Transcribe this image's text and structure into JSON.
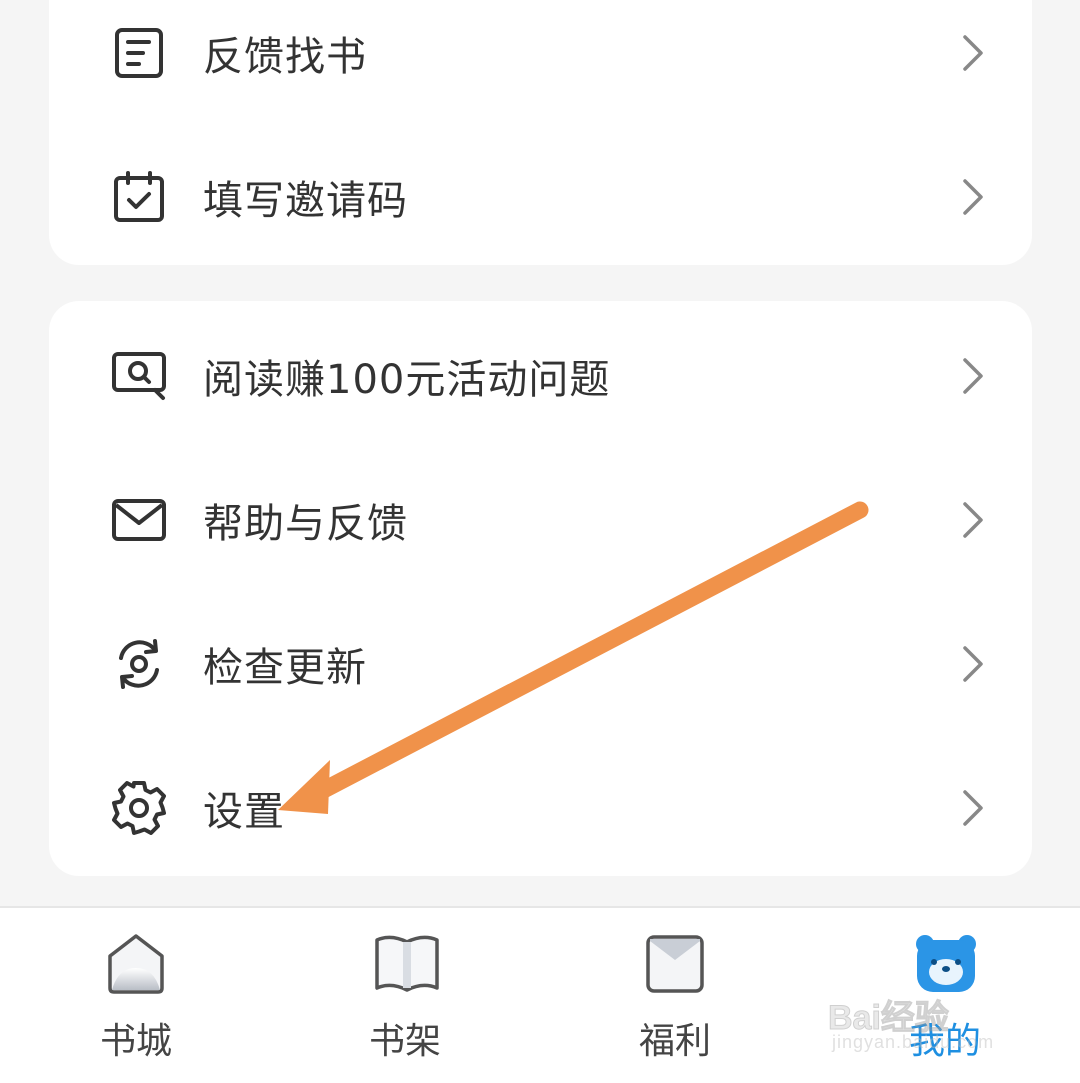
{
  "menu_top": [
    {
      "label": "反馈找书",
      "icon": "document-icon"
    },
    {
      "label": "填写邀请码",
      "icon": "calendar-check-icon"
    }
  ],
  "menu_main": [
    {
      "label": "阅读赚100元活动问题",
      "icon": "search-screen-icon"
    },
    {
      "label": "帮助与反馈",
      "icon": "mail-icon"
    },
    {
      "label": "检查更新",
      "icon": "refresh-icon"
    },
    {
      "label": "设置",
      "icon": "gear-icon"
    }
  ],
  "bottom_nav": [
    {
      "label": "书城",
      "icon": "home-icon",
      "active": false
    },
    {
      "label": "书架",
      "icon": "book-icon",
      "active": false
    },
    {
      "label": "福利",
      "icon": "envelope-icon",
      "active": false
    },
    {
      "label": "我的",
      "icon": "bear-icon",
      "active": true
    }
  ],
  "watermark": {
    "logo": "Bai经验",
    "sub": "jingyan.baidu.com"
  },
  "colors": {
    "accent": "#1e8fe1",
    "annotation_arrow": "#f0924a",
    "text": "#333333",
    "chevron": "#888888"
  }
}
